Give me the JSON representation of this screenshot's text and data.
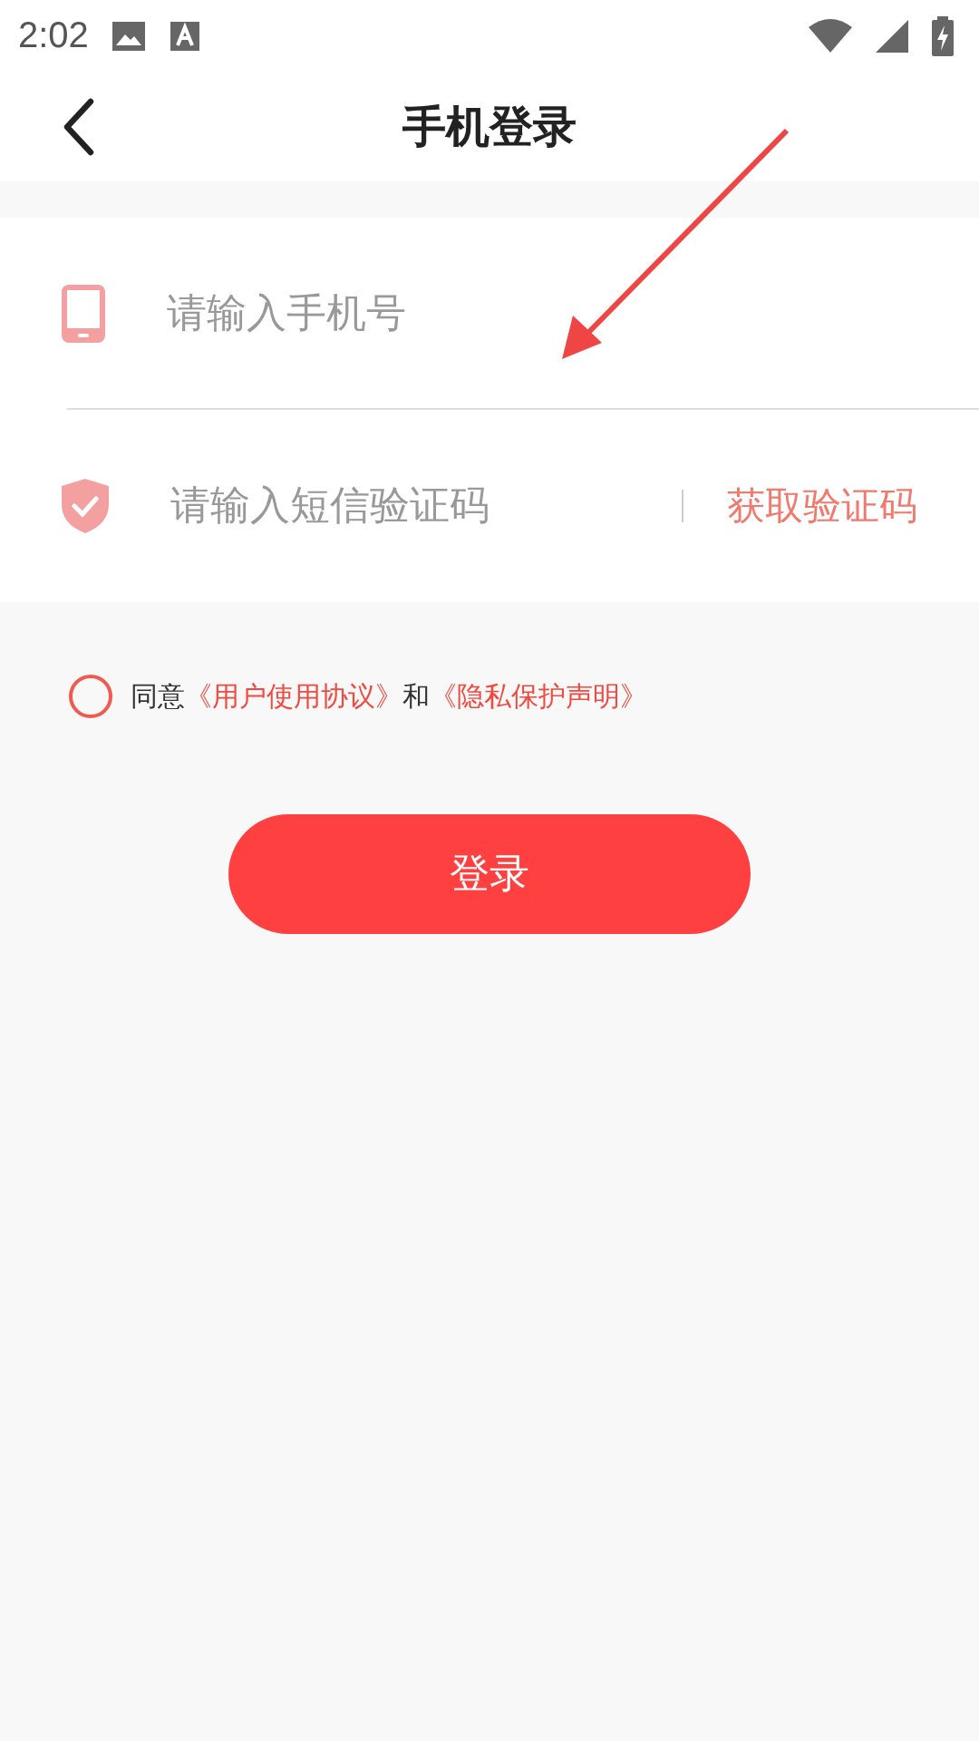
{
  "status_bar": {
    "time": "2:02"
  },
  "header": {
    "title": "手机登录"
  },
  "fields": [
    {
      "kind": "phone",
      "placeholder": "请输入手机号"
    },
    {
      "kind": "code",
      "placeholder": "请输入短信验证码",
      "action": "获取验证码"
    }
  ],
  "agreement": {
    "checked": false,
    "prefix": "同意",
    "links": [
      "《用户使用协议》",
      "《隐私保护声明》"
    ],
    "joiner": "和"
  },
  "login_button": {
    "label": "登录"
  }
}
